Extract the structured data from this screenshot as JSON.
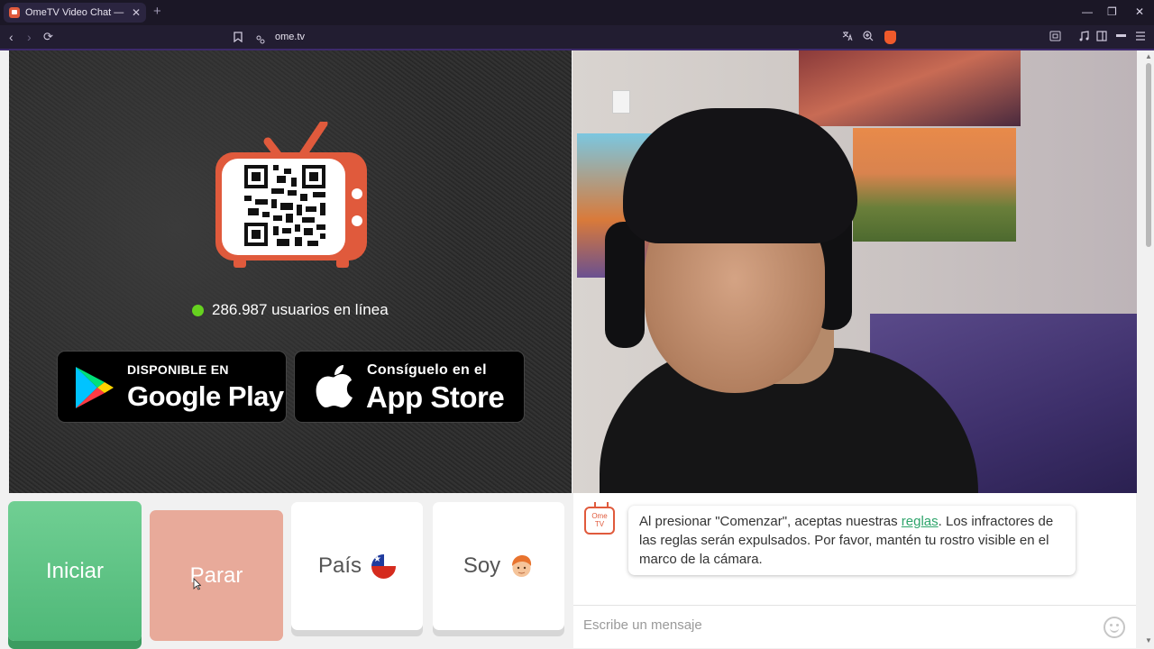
{
  "browser": {
    "tab_title": "OmeTV Video Chat — Omeg",
    "tab_close": "✕",
    "new_tab": "+",
    "url": "ome.tv",
    "controls": {
      "minimize": "—",
      "restore": "❐",
      "close": "✕"
    },
    "nav": {
      "back": "‹",
      "forward": "›",
      "reload": "⟳",
      "bookmark": "⌂",
      "site_info": "⚲"
    },
    "right_icons": [
      "translate-icon",
      "zoom-icon",
      "brave-shield-icon",
      "extensions-icon",
      "media-icon",
      "sidebar-icon",
      "wallet-icon",
      "menu-icon"
    ]
  },
  "promo": {
    "online_text": "286.987 usuarios en línea",
    "online_color": "#66d21f",
    "google_play": {
      "small": "DISPONIBLE EN",
      "big": "Google Play"
    },
    "app_store": {
      "small": "Consíguelo en el",
      "big": "App Store"
    },
    "brand_color": "#e05a3c"
  },
  "controls": {
    "start": "Iniciar",
    "stop": "Parar",
    "country": "País",
    "country_flag": "chile-flag-icon",
    "gender": "Soy",
    "gender_icon": "boy-avatar-icon",
    "start_color": "#5cc284",
    "stop_color": "#e8aa9a"
  },
  "chat": {
    "logo_line1": "Ome",
    "logo_line2": "TV",
    "message_before": "Al presionar \"Comenzar\", aceptas nuestras ",
    "message_link": "reglas",
    "message_after": ". Los infractores de las reglas serán expulsados. Por favor, mantén tu rostro visible en el marco de la cámara.",
    "input_placeholder": "Escribe un mensaje"
  }
}
